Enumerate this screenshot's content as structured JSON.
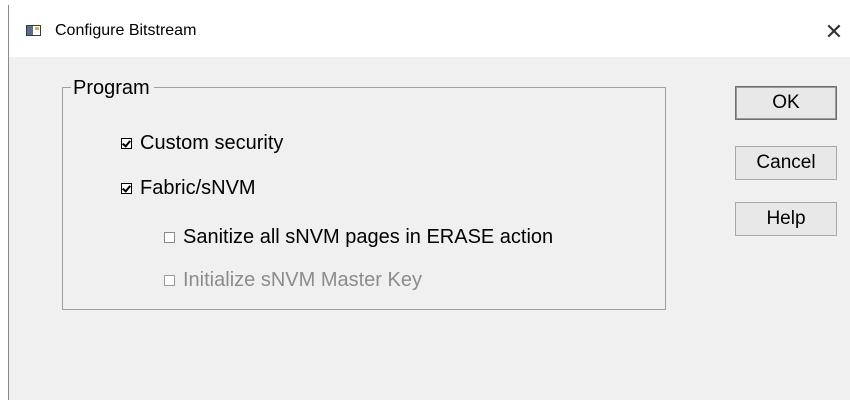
{
  "window": {
    "title": "Configure Bitstream",
    "close_glyph": "✕",
    "icon": "app-window-icon"
  },
  "program_group": {
    "label": "Program",
    "options": [
      {
        "label": "Custom security",
        "checked": true,
        "enabled": true
      },
      {
        "label": "Fabric/sNVM",
        "checked": true,
        "enabled": true
      },
      {
        "label": "Sanitize all  sNVM pages in ERASE action",
        "checked": false,
        "enabled": true
      },
      {
        "label": "Initialize sNVM Master Key",
        "checked": false,
        "enabled": false
      }
    ]
  },
  "buttons": {
    "ok_label": "OK",
    "cancel_label": "Cancel",
    "help_label": "Help"
  },
  "colors": {
    "dialog_background": "#f0f0f0",
    "titlebar_background": "#ffffff",
    "disabled_text": "#8c8c8c"
  }
}
